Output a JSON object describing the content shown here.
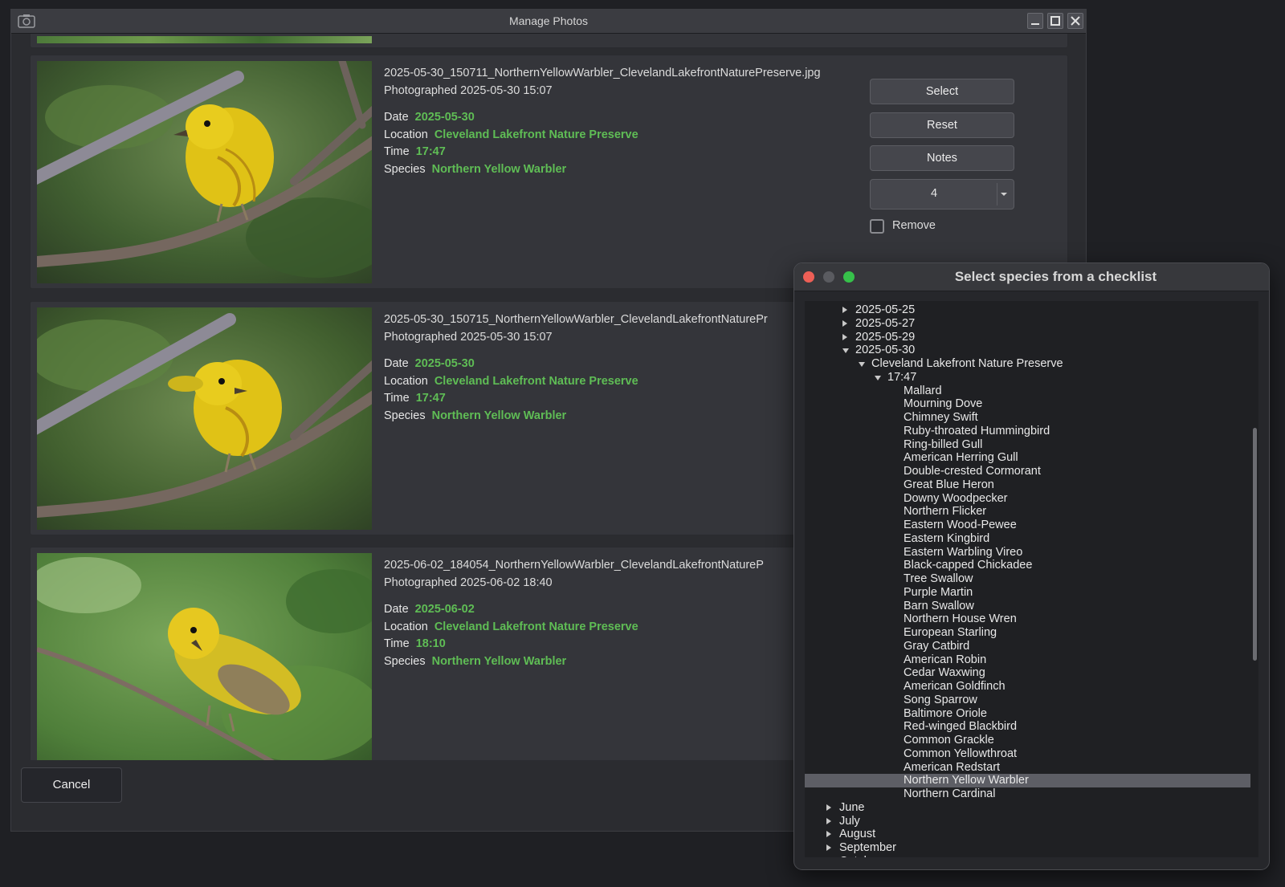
{
  "main_window": {
    "title": "Manage Photos",
    "buttons": {
      "minimize": "minimize-icon",
      "maximize": "maximize-icon",
      "close": "close-icon"
    }
  },
  "photos": [
    {
      "filename": "2025-05-30_150711_NorthernYellowWarbler_ClevelandLakefrontNaturePreserve.jpg",
      "photographed": "Photographed 2025-05-30 15:07",
      "date_label": "Date",
      "date": "2025-05-30",
      "location_label": "Location",
      "location": "Cleveland Lakefront Nature Preserve",
      "time_label": "Time",
      "time": "17:47",
      "species_label": "Species",
      "species": "Northern Yellow Warbler"
    },
    {
      "filename": "2025-05-30_150715_NorthernYellowWarbler_ClevelandLakefrontNaturePr",
      "photographed": "Photographed 2025-05-30 15:07",
      "date_label": "Date",
      "date": "2025-05-30",
      "location_label": "Location",
      "location": "Cleveland Lakefront Nature Preserve",
      "time_label": "Time",
      "time": "17:47",
      "species_label": "Species",
      "species": "Northern Yellow Warbler"
    },
    {
      "filename": "2025-06-02_184054_NorthernYellowWarbler_ClevelandLakefrontNatureP",
      "photographed": "Photographed 2025-06-02 18:40",
      "date_label": "Date",
      "date": "2025-06-02",
      "location_label": "Location",
      "location": "Cleveland Lakefront Nature Preserve",
      "time_label": "Time",
      "time": "18:10",
      "species_label": "Species",
      "species": "Northern Yellow Warbler"
    }
  ],
  "actions": {
    "select_label": "Select",
    "reset_label": "Reset",
    "notes_label": "Notes",
    "count_value": "4",
    "remove_label": "Remove"
  },
  "cancel_label": "Cancel",
  "checklist_dialog": {
    "title": "Select species from a checklist",
    "tree": [
      {
        "label": "2025-05-25",
        "level": 1,
        "toggle": "closed"
      },
      {
        "label": "2025-05-27",
        "level": 1,
        "toggle": "closed"
      },
      {
        "label": "2025-05-29",
        "level": 1,
        "toggle": "closed"
      },
      {
        "label": "2025-05-30",
        "level": 1,
        "toggle": "open"
      },
      {
        "label": "Cleveland Lakefront Nature Preserve",
        "level": 2,
        "toggle": "open"
      },
      {
        "label": "17:47",
        "level": 3,
        "toggle": "open"
      },
      {
        "label": "Mallard",
        "level": 4,
        "toggle": "none"
      },
      {
        "label": "Mourning Dove",
        "level": 4,
        "toggle": "none"
      },
      {
        "label": "Chimney Swift",
        "level": 4,
        "toggle": "none"
      },
      {
        "label": "Ruby-throated Hummingbird",
        "level": 4,
        "toggle": "none"
      },
      {
        "label": "Ring-billed Gull",
        "level": 4,
        "toggle": "none"
      },
      {
        "label": "American Herring Gull",
        "level": 4,
        "toggle": "none"
      },
      {
        "label": "Double-crested Cormorant",
        "level": 4,
        "toggle": "none"
      },
      {
        "label": "Great Blue Heron",
        "level": 4,
        "toggle": "none"
      },
      {
        "label": "Downy Woodpecker",
        "level": 4,
        "toggle": "none"
      },
      {
        "label": "Northern Flicker",
        "level": 4,
        "toggle": "none"
      },
      {
        "label": "Eastern Wood-Pewee",
        "level": 4,
        "toggle": "none"
      },
      {
        "label": "Eastern Kingbird",
        "level": 4,
        "toggle": "none"
      },
      {
        "label": "Eastern Warbling Vireo",
        "level": 4,
        "toggle": "none"
      },
      {
        "label": "Black-capped Chickadee",
        "level": 4,
        "toggle": "none"
      },
      {
        "label": "Tree Swallow",
        "level": 4,
        "toggle": "none"
      },
      {
        "label": "Purple Martin",
        "level": 4,
        "toggle": "none"
      },
      {
        "label": "Barn Swallow",
        "level": 4,
        "toggle": "none"
      },
      {
        "label": "Northern House Wren",
        "level": 4,
        "toggle": "none"
      },
      {
        "label": "European Starling",
        "level": 4,
        "toggle": "none"
      },
      {
        "label": "Gray Catbird",
        "level": 4,
        "toggle": "none"
      },
      {
        "label": "American Robin",
        "level": 4,
        "toggle": "none"
      },
      {
        "label": "Cedar Waxwing",
        "level": 4,
        "toggle": "none"
      },
      {
        "label": "American Goldfinch",
        "level": 4,
        "toggle": "none"
      },
      {
        "label": "Song Sparrow",
        "level": 4,
        "toggle": "none"
      },
      {
        "label": "Baltimore Oriole",
        "level": 4,
        "toggle": "none"
      },
      {
        "label": "Red-winged Blackbird",
        "level": 4,
        "toggle": "none"
      },
      {
        "label": "Common Grackle",
        "level": 4,
        "toggle": "none"
      },
      {
        "label": "Common Yellowthroat",
        "level": 4,
        "toggle": "none"
      },
      {
        "label": "American Redstart",
        "level": 4,
        "toggle": "none"
      },
      {
        "label": "Northern Yellow Warbler",
        "level": 4,
        "toggle": "none",
        "selected": true
      },
      {
        "label": "Northern Cardinal",
        "level": 4,
        "toggle": "none"
      },
      {
        "label": "June",
        "level": 0,
        "toggle": "closed"
      },
      {
        "label": "July",
        "level": 0,
        "toggle": "closed"
      },
      {
        "label": "August",
        "level": 0,
        "toggle": "closed"
      },
      {
        "label": "September",
        "level": 0,
        "toggle": "closed"
      },
      {
        "label": "October",
        "level": 0,
        "toggle": "closed"
      }
    ]
  },
  "colors": {
    "accent_value": "#5fbd55",
    "traffic_close": "#ed5f56",
    "traffic_minimize": "#5a5b60",
    "traffic_zoom": "#36c14a",
    "selection": "#5d5e65"
  }
}
